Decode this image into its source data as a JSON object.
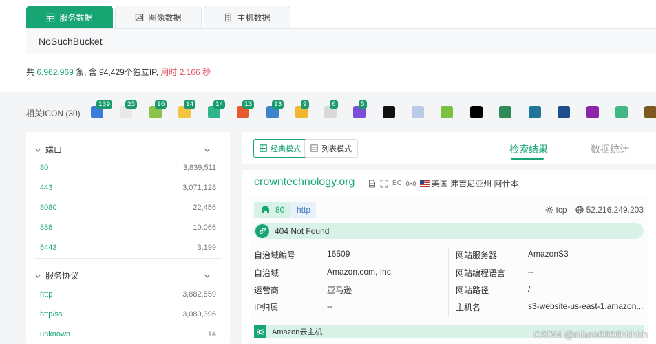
{
  "search": {
    "tabs": [
      {
        "label": "服务数据",
        "icon": "table-icon",
        "active": true
      },
      {
        "label": "图像数据",
        "icon": "image-icon",
        "active": false
      },
      {
        "label": "主机数据",
        "icon": "host-icon",
        "active": false
      }
    ],
    "query": "NoSuchBucket"
  },
  "stats": {
    "prefix": "共",
    "total": "6,962,969",
    "mid1": "条, 含",
    "ip_count": "94,429",
    "mid2": "个独立IP,",
    "time": "用时 2.166 秒"
  },
  "icons": {
    "label": "相关ICON (30)",
    "items": [
      {
        "name": "icon-1",
        "badge": "139",
        "color": "#3b7dd8"
      },
      {
        "name": "icon-2",
        "badge": "25",
        "color": "#e8e8e8"
      },
      {
        "name": "icon-3",
        "badge": "16",
        "color": "#8bc34a"
      },
      {
        "name": "icon-4",
        "badge": "14",
        "color": "#f5c342"
      },
      {
        "name": "icon-5",
        "badge": "14",
        "color": "#2fb58a"
      },
      {
        "name": "icon-6",
        "badge": "13",
        "color": "#e85a2d"
      },
      {
        "name": "icon-7",
        "badge": "13",
        "color": "#3a86c8"
      },
      {
        "name": "icon-8",
        "badge": "9",
        "color": "#f2b632"
      },
      {
        "name": "icon-9",
        "badge": "6",
        "color": "#d9d9d9"
      },
      {
        "name": "icon-10",
        "badge": "5",
        "color": "#7c4dd8"
      },
      {
        "name": "icon-11",
        "badge": "",
        "color": "#111111"
      },
      {
        "name": "icon-12",
        "badge": "",
        "color": "#b9cbe6"
      },
      {
        "name": "icon-13",
        "badge": "",
        "color": "#7cc142"
      },
      {
        "name": "icon-14",
        "badge": "",
        "color": "#000000"
      },
      {
        "name": "icon-15",
        "badge": "",
        "color": "#2e8b57"
      },
      {
        "name": "icon-16",
        "badge": "",
        "color": "#21759b"
      },
      {
        "name": "icon-17",
        "badge": "",
        "color": "#1f4e8c"
      },
      {
        "name": "icon-18",
        "badge": "",
        "color": "#8e24aa"
      },
      {
        "name": "icon-19",
        "badge": "",
        "color": "#41b883"
      },
      {
        "name": "icon-20",
        "badge": "",
        "color": "#7a5a1e"
      }
    ]
  },
  "facets": {
    "port": {
      "title": "端口",
      "items": [
        {
          "key": "80",
          "count": "3,839,511"
        },
        {
          "key": "443",
          "count": "3,071,128"
        },
        {
          "key": "8080",
          "count": "22,456"
        },
        {
          "key": "888",
          "count": "10,066"
        },
        {
          "key": "5443",
          "count": "3,199"
        }
      ]
    },
    "protocol": {
      "title": "服务协议",
      "items": [
        {
          "key": "http",
          "count": "3,882,559"
        },
        {
          "key": "http/ssl",
          "count": "3,080,396"
        },
        {
          "key": "unknown",
          "count": "14"
        }
      ]
    }
  },
  "view": {
    "modes": [
      "经典模式",
      "列表模式"
    ],
    "tabs": [
      "检索结果",
      "数据统计"
    ]
  },
  "result": {
    "domain": "crowntechnology.org",
    "location": "美国 弗吉尼亚州 阿什本",
    "ec_label": "EC",
    "port": "80",
    "protocol": "http",
    "transport": "tcp",
    "ip": "52.216.249.203",
    "status": "404 Not Found",
    "left_info": [
      {
        "label": "自治域编号",
        "value": "16509"
      },
      {
        "label": "自治域",
        "value": "Amazon.com, Inc."
      },
      {
        "label": "运营商",
        "value": "亚马逊"
      },
      {
        "label": "IP归属",
        "value": "--"
      }
    ],
    "right_info": [
      {
        "label": "网站服务器",
        "value": "AmazonS3"
      },
      {
        "label": "网站编程语言",
        "value": "--"
      },
      {
        "label": "网站路径",
        "value": "/"
      },
      {
        "label": "主机名",
        "value": "s3-website-us-east-1.amazon..."
      }
    ],
    "tag": "Amazon云主机"
  },
  "watermark": "CSDN @nihao6666hhhhh"
}
